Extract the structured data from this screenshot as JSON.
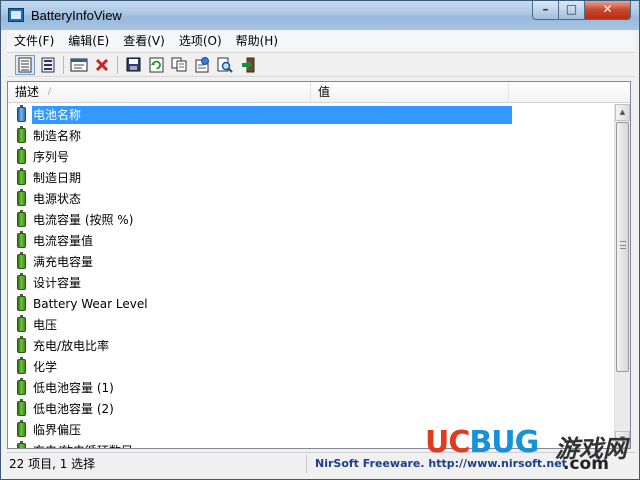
{
  "window": {
    "title": "BatteryInfoView",
    "controls": {
      "minimize": "–",
      "maximize": "□",
      "close": "✕"
    }
  },
  "menu": [
    "文件(F)",
    "编辑(E)",
    "查看(V)",
    "选项(O)",
    "帮助(H)"
  ],
  "toolbar": {
    "icons": [
      "battery-info-mode-icon",
      "battery-log-mode-icon",
      "properties-icon",
      "delete-icon",
      "save-icon",
      "refresh-icon",
      "copy-icon",
      "html-report-icon",
      "find-icon",
      "exit-icon"
    ]
  },
  "list": {
    "columns": [
      "描述",
      "值",
      ""
    ],
    "sort_indicator": "/",
    "rows": [
      "电池名称",
      "制造名称",
      "序列号",
      "制造日期",
      "电源状态",
      "电流容量 (按照 %)",
      "电流容量值",
      "满充电容量",
      "设计容量",
      "Battery Wear Level",
      "电压",
      "充电/放电比率",
      "化学",
      "低电池容量 (1)",
      "低电池容量 (2)",
      "临界偏压",
      "充电/放电循环数目"
    ],
    "selected_index": 0
  },
  "status": {
    "left": "22 项目, 1 选择",
    "right": "NirSoft Freeware.  http://www.nirsoft.net"
  },
  "watermark": {
    "logo_uc": "UC",
    "logo_bug": "BUG",
    "logo_cn": "游戏网",
    "logo_com": ".com"
  },
  "colors": {
    "selection": "#3399ff",
    "battery": "#5fb32e",
    "status_link": "#1b3e8e",
    "watermark_red": "#e03b1f",
    "watermark_blue": "#1592d8"
  }
}
